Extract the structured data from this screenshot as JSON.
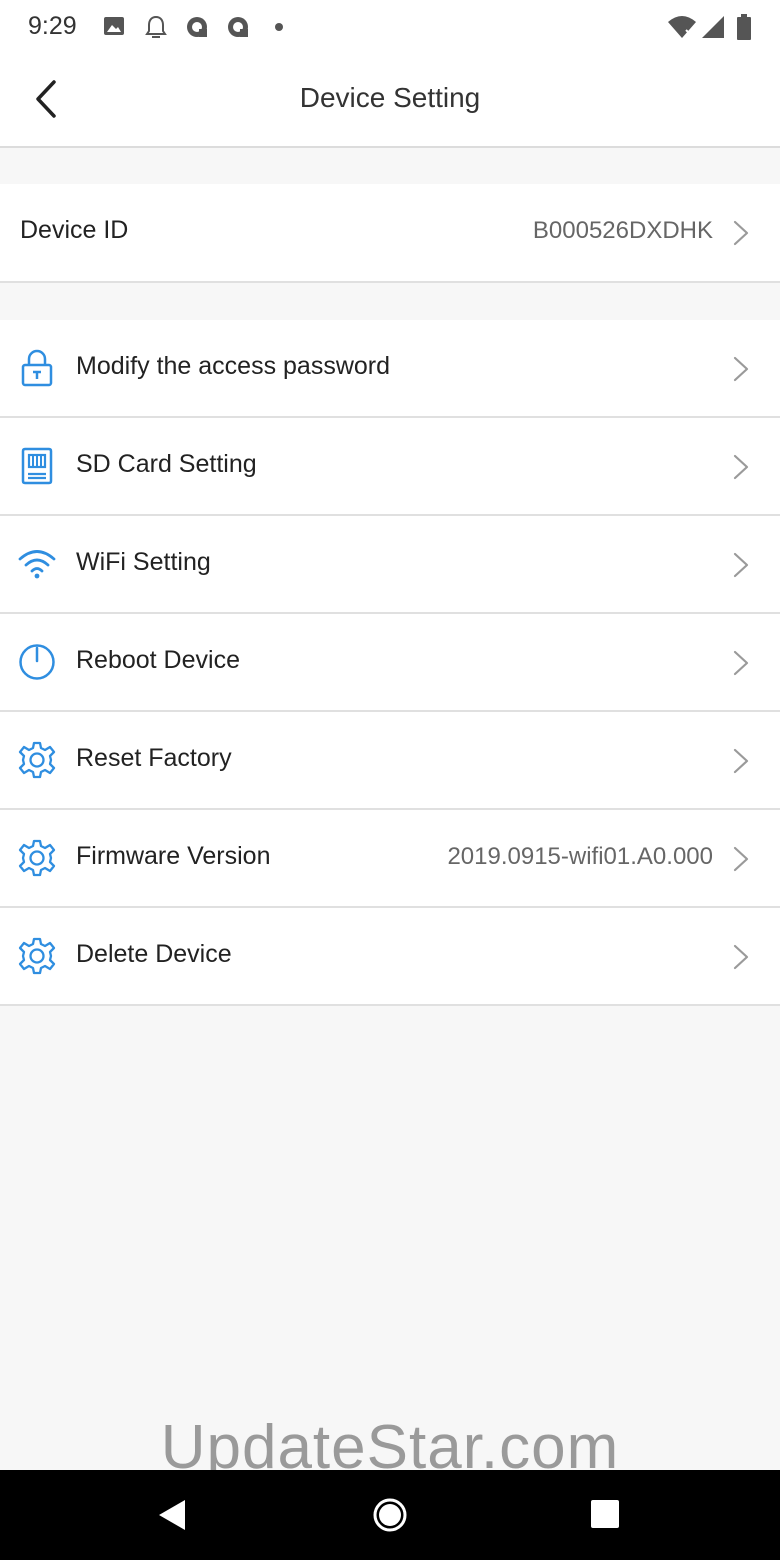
{
  "status_bar": {
    "time": "9:29",
    "icons": [
      "image-icon",
      "notification-icon",
      "sync-icon",
      "sync-icon",
      "dot-icon",
      "wifi-icon",
      "signal-icon",
      "battery-icon"
    ]
  },
  "header": {
    "title": "Device Setting",
    "back_icon": "chevron-left-icon"
  },
  "device_id": {
    "label": "Device ID",
    "value": "B000526DXDHK"
  },
  "settings": {
    "items": [
      {
        "label": "Modify the access password",
        "icon": "lock-icon"
      },
      {
        "label": "SD Card Setting",
        "icon": "sd-card-icon"
      },
      {
        "label": "WiFi Setting",
        "icon": "wifi-icon"
      },
      {
        "label": "Reboot Device",
        "icon": "power-icon"
      },
      {
        "label": "Reset Factory",
        "icon": "gear-icon"
      },
      {
        "label": "Firmware Version",
        "icon": "gear-icon",
        "value": "2019.0915-wifi01.A0.000"
      },
      {
        "label": "Delete Device",
        "icon": "gear-icon"
      }
    ]
  },
  "watermark": "UpdateStar.com",
  "nav_bar": {
    "buttons": [
      "back-triangle-icon",
      "home-circle-icon",
      "recents-square-icon"
    ]
  },
  "colors": {
    "accent": "#2f8ee0",
    "background": "#f7f7f7",
    "divider": "#e0e0e0"
  }
}
